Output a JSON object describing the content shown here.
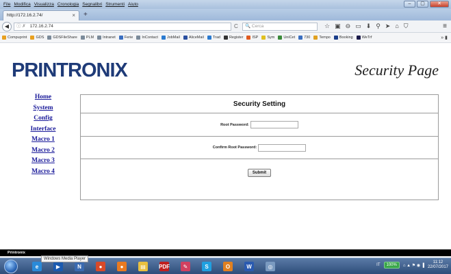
{
  "browser": {
    "menu": [
      "File",
      "Modifica",
      "Visualizza",
      "Cronologia",
      "Segnalibri",
      "Strumenti",
      "Aiuto"
    ],
    "tab_title": "http://172.16.2.74/",
    "tab_close": "×",
    "new_tab": "+",
    "url": "172.16.2.74",
    "search_placeholder": "Cerca",
    "bookmarks": [
      {
        "label": "Compuprint",
        "color": "#e8a020"
      },
      {
        "label": "GDS",
        "color": "#e8a020"
      },
      {
        "label": "GDSFileShare",
        "color": "#7a8a9a"
      },
      {
        "label": "PLM",
        "color": "#7a8a9a"
      },
      {
        "label": "Intranet",
        "color": "#7a8a9a"
      },
      {
        "label": "Ferie",
        "color": "#3a6ec0"
      },
      {
        "label": "InContact",
        "color": "#7a8a9a"
      },
      {
        "label": "JobMail",
        "color": "#2a7ad0"
      },
      {
        "label": "AliceMail",
        "color": "#2a4fa0"
      },
      {
        "label": "Trad",
        "color": "#2a7ad0"
      },
      {
        "label": "Register",
        "color": "#333333"
      },
      {
        "label": "ISP",
        "color": "#e05a20"
      },
      {
        "label": "Sym",
        "color": "#e0c020"
      },
      {
        "label": "UniCet",
        "color": "#3a8a3a"
      },
      {
        "label": "730",
        "color": "#3a6ec0"
      },
      {
        "label": "Tempo",
        "color": "#e0a020"
      },
      {
        "label": "Booking",
        "color": "#1a3e8a"
      },
      {
        "label": "WeTrf",
        "color": "#1a1a4a"
      }
    ]
  },
  "page": {
    "logo": "PRINTRONIX",
    "title": "Security Page",
    "nav": [
      "Home",
      "System",
      "Config",
      "Interface",
      "Macro 1",
      "Macro 2",
      "Macro 3",
      "Macro 4"
    ],
    "panel_title": "Security Setting",
    "root_password_label": "Root Password:",
    "confirm_password_label": "Confirm Root Password:",
    "root_password_value": "",
    "confirm_password_value": "",
    "submit_label": "Submit"
  },
  "status": {
    "text": "Printronix",
    "tooltip": "Windows Media Player"
  },
  "taskbar": {
    "apps": [
      {
        "name": "internet-explorer",
        "glyph": "e",
        "color": "#2a8ad8"
      },
      {
        "name": "media-player",
        "glyph": "▶",
        "color": "#1a5ab0"
      },
      {
        "name": "unknown-app",
        "glyph": "N",
        "color": "#3a6ab0"
      },
      {
        "name": "chrome",
        "glyph": "●",
        "color": "#d84a2a"
      },
      {
        "name": "firefox",
        "glyph": "●",
        "color": "#e87a20"
      },
      {
        "name": "file-explorer",
        "glyph": "▤",
        "color": "#e8c040"
      },
      {
        "name": "pdf-reader",
        "glyph": "PDF",
        "color": "#c02020"
      },
      {
        "name": "paint-app",
        "glyph": "✎",
        "color": "#d04060"
      },
      {
        "name": "skype",
        "glyph": "S",
        "color": "#20a0e0"
      },
      {
        "name": "outlook",
        "glyph": "O",
        "color": "#e08020"
      },
      {
        "name": "word",
        "glyph": "W",
        "color": "#2a5ab0"
      },
      {
        "name": "network-app",
        "glyph": "◎",
        "color": "#7a9ac0"
      }
    ],
    "lang": "IT",
    "zoom": "100%",
    "time": "11:12",
    "date": "22/07/2017"
  }
}
